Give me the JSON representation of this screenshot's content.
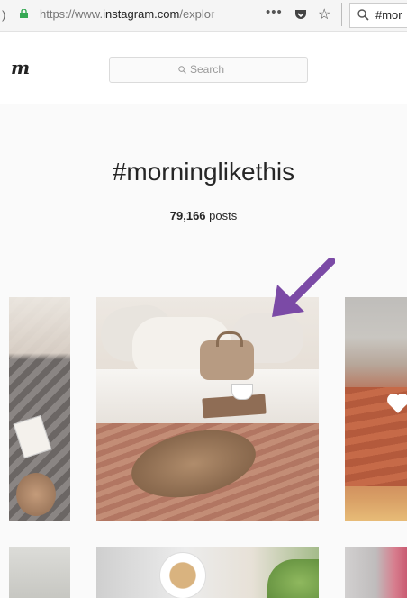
{
  "browser": {
    "url_host_prefix": "https://www.",
    "url_domain": "instagram.com",
    "url_path": "/explo",
    "url_fade": "r",
    "menu_dots": "•••",
    "search_text": "#mor"
  },
  "header": {
    "logo_text": "m",
    "search_placeholder": "Search"
  },
  "hashtag": {
    "title": "#morninglikethis",
    "posts_count": "79,166",
    "posts_label": "posts"
  },
  "colors": {
    "arrow": "#7b4aa6",
    "lock": "#35a853"
  },
  "icons": [
    "lock-icon",
    "menu-dots-icon",
    "pocket-icon",
    "star-icon",
    "search-icon",
    "arrow-icon",
    "heart-icon"
  ]
}
